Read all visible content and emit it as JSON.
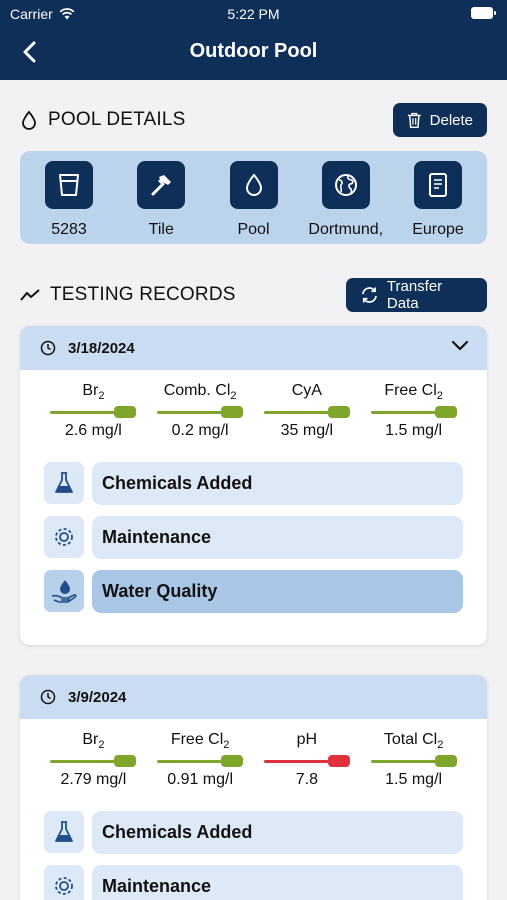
{
  "status": {
    "carrier": "Carrier",
    "time": "5:22 PM"
  },
  "nav": {
    "title": "Outdoor Pool"
  },
  "pool_details": {
    "heading": "POOL DETAILS",
    "delete_label": "Delete",
    "items": [
      {
        "label": "5283",
        "icon": "volume-icon"
      },
      {
        "label": "Tile",
        "icon": "hammer-icon"
      },
      {
        "label": "Pool",
        "icon": "water-drop-icon"
      },
      {
        "label": "Dortmund,",
        "icon": "globe-icon"
      },
      {
        "label": "Europe",
        "icon": "document-icon"
      }
    ]
  },
  "testing_records": {
    "heading": "TESTING RECORDS",
    "transfer_label": "Transfer Data",
    "records": [
      {
        "date": "3/18/2024",
        "metrics": [
          {
            "name": "Br",
            "sub": "2",
            "value": "2.6 mg/l",
            "status": "ok"
          },
          {
            "name": "Comb. Cl",
            "sub": "2",
            "value": "0.2 mg/l",
            "status": "ok"
          },
          {
            "name": "CyA",
            "sub": "",
            "value": "35 mg/l",
            "status": "ok"
          },
          {
            "name": "Free Cl",
            "sub": "2",
            "value": "1.5 mg/l",
            "status": "ok"
          }
        ],
        "rows": [
          {
            "label": "Chemicals Added",
            "icon": "flask-icon"
          },
          {
            "label": "Maintenance",
            "icon": "gear-icon"
          },
          {
            "label": "Water Quality",
            "icon": "water-hand-icon"
          }
        ]
      },
      {
        "date": "3/9/2024",
        "metrics": [
          {
            "name": "Br",
            "sub": "2",
            "value": "2.79 mg/l",
            "status": "ok"
          },
          {
            "name": "Free Cl",
            "sub": "2",
            "value": "0.91 mg/l",
            "status": "ok"
          },
          {
            "name": "pH",
            "sub": "",
            "value": "7.8",
            "status": "alert"
          },
          {
            "name": "Total Cl",
            "sub": "2",
            "value": "1.5 mg/l",
            "status": "ok"
          }
        ],
        "rows": [
          {
            "label": "Chemicals Added",
            "icon": "flask-icon"
          },
          {
            "label": "Maintenance",
            "icon": "gear-icon"
          }
        ]
      }
    ]
  },
  "colors": {
    "navy": "#0e2f57",
    "ok": "#7fa52b",
    "alert": "#e0323c",
    "accent_light": "#bcd3ec"
  }
}
